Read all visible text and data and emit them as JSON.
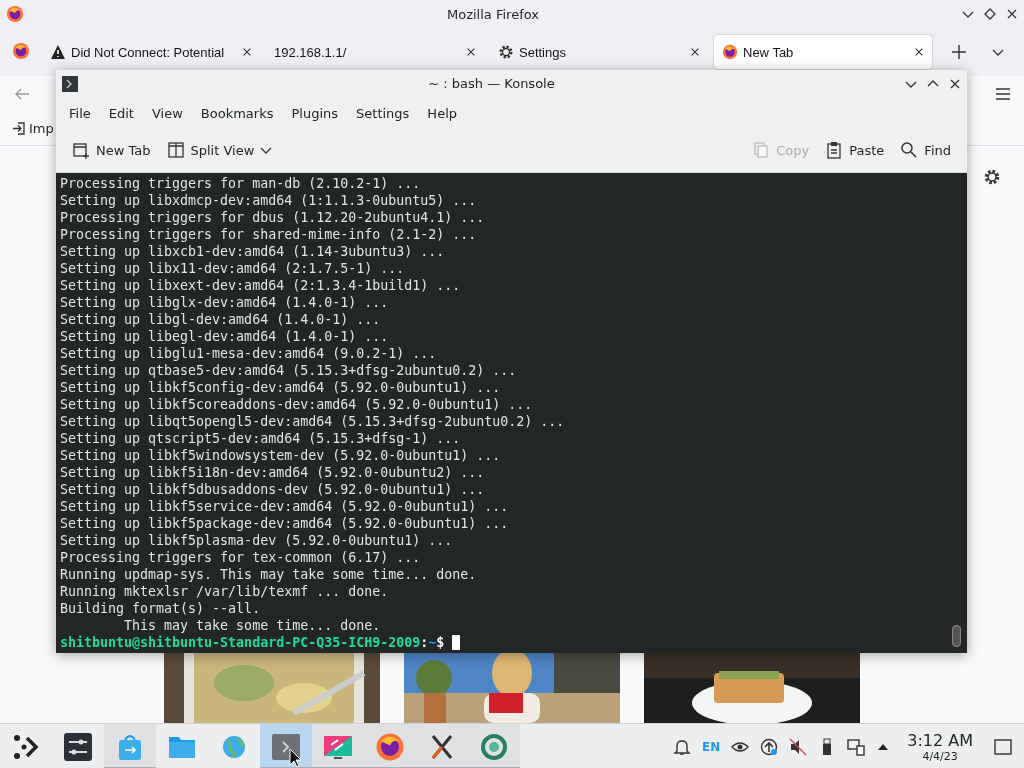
{
  "browser": {
    "title": "Mozilla Firefox",
    "tabs": [
      {
        "label": "Did Not Connect: Potential",
        "kind": "warning",
        "selected": false
      },
      {
        "label": "192.168.1.1/",
        "kind": "plain",
        "selected": false
      },
      {
        "label": "Settings",
        "kind": "gear",
        "selected": false
      },
      {
        "label": "New Tab",
        "kind": "firefox",
        "selected": true
      }
    ],
    "bookmarks": [
      {
        "label": "Imp"
      }
    ]
  },
  "konsole": {
    "title": "~ : bash — Konsole",
    "menu": [
      "File",
      "Edit",
      "View",
      "Bookmarks",
      "Plugins",
      "Settings",
      "Help"
    ],
    "toolbar": [
      {
        "label": "New Tab",
        "kind": "new-tab",
        "dropdown": false,
        "disabled": false
      },
      {
        "label": "Split View",
        "kind": "split",
        "dropdown": true,
        "disabled": false
      },
      {
        "label": "Copy",
        "kind": "copy",
        "dropdown": false,
        "disabled": true
      },
      {
        "label": "Paste",
        "kind": "paste",
        "dropdown": false,
        "disabled": false
      },
      {
        "label": "Find",
        "kind": "search",
        "dropdown": false,
        "disabled": false
      }
    ],
    "lines": [
      "Processing triggers for man-db (2.10.2-1) ...",
      "Setting up libxdmcp-dev:amd64 (1:1.1.3-0ubuntu5) ...",
      "Processing triggers for dbus (1.12.20-2ubuntu4.1) ...",
      "Processing triggers for shared-mime-info (2.1-2) ...",
      "Setting up libxcb1-dev:amd64 (1.14-3ubuntu3) ...",
      "Setting up libx11-dev:amd64 (2:1.7.5-1) ...",
      "Setting up libxext-dev:amd64 (2:1.3.4-1build1) ...",
      "Setting up libglx-dev:amd64 (1.4.0-1) ...",
      "Setting up libgl-dev:amd64 (1.4.0-1) ...",
      "Setting up libegl-dev:amd64 (1.4.0-1) ...",
      "Setting up libglu1-mesa-dev:amd64 (9.0.2-1) ...",
      "Setting up qtbase5-dev:amd64 (5.15.3+dfsg-2ubuntu0.2) ...",
      "Setting up libkf5config-dev:amd64 (5.92.0-0ubuntu1) ...",
      "Setting up libkf5coreaddons-dev:amd64 (5.92.0-0ubuntu1) ...",
      "Setting up libqt5opengl5-dev:amd64 (5.15.3+dfsg-2ubuntu0.2) ...",
      "Setting up qtscript5-dev:amd64 (5.15.3+dfsg-1) ...",
      "Setting up libkf5windowsystem-dev (5.92.0-0ubuntu1) ...",
      "Setting up libkf5i18n-dev:amd64 (5.92.0-0ubuntu2) ...",
      "Setting up libkf5dbusaddons-dev (5.92.0-0ubuntu1) ...",
      "Setting up libkf5service-dev:amd64 (5.92.0-0ubuntu1) ...",
      "Setting up libkf5package-dev:amd64 (5.92.0-0ubuntu1) ...",
      "Setting up libkf5plasma-dev (5.92.0-0ubuntu1) ...",
      "Processing triggers for tex-common (6.17) ...",
      "Running updmap-sys. This may take some time... done.",
      "Running mktexlsr /var/lib/texmf ... done.",
      "Building format(s) --all.",
      "        This may take some time... done."
    ],
    "prompt": {
      "user_host": "shitbuntu@shitbuntu-Standard-PC-Q35-ICH9-2009",
      "separator": ":",
      "path": "~",
      "symbol": "$"
    }
  },
  "taskbar": {
    "tasks": [
      {
        "kind": "launcher",
        "running": false,
        "selected": false
      },
      {
        "kind": "sliders",
        "running": false,
        "selected": false
      },
      {
        "kind": "store",
        "running": true,
        "selected": false
      },
      {
        "kind": "folder",
        "running": false,
        "selected": false
      },
      {
        "kind": "globe",
        "running": false,
        "selected": false
      },
      {
        "kind": "terminal",
        "running": true,
        "selected": true
      },
      {
        "kind": "screen",
        "running": true,
        "selected": false
      },
      {
        "kind": "firefox",
        "running": true,
        "selected": false
      },
      {
        "kind": "x-app",
        "running": true,
        "selected": false
      },
      {
        "kind": "ring",
        "running": true,
        "selected": false
      }
    ],
    "tray": [
      {
        "kind": "bell"
      },
      {
        "kind": "text",
        "label": "EN"
      },
      {
        "kind": "eye"
      },
      {
        "kind": "update"
      },
      {
        "kind": "muted"
      },
      {
        "kind": "usb"
      },
      {
        "kind": "network"
      },
      {
        "kind": "expand"
      }
    ],
    "clock": {
      "time": "3:12 AM",
      "date": "4/4/23"
    }
  }
}
